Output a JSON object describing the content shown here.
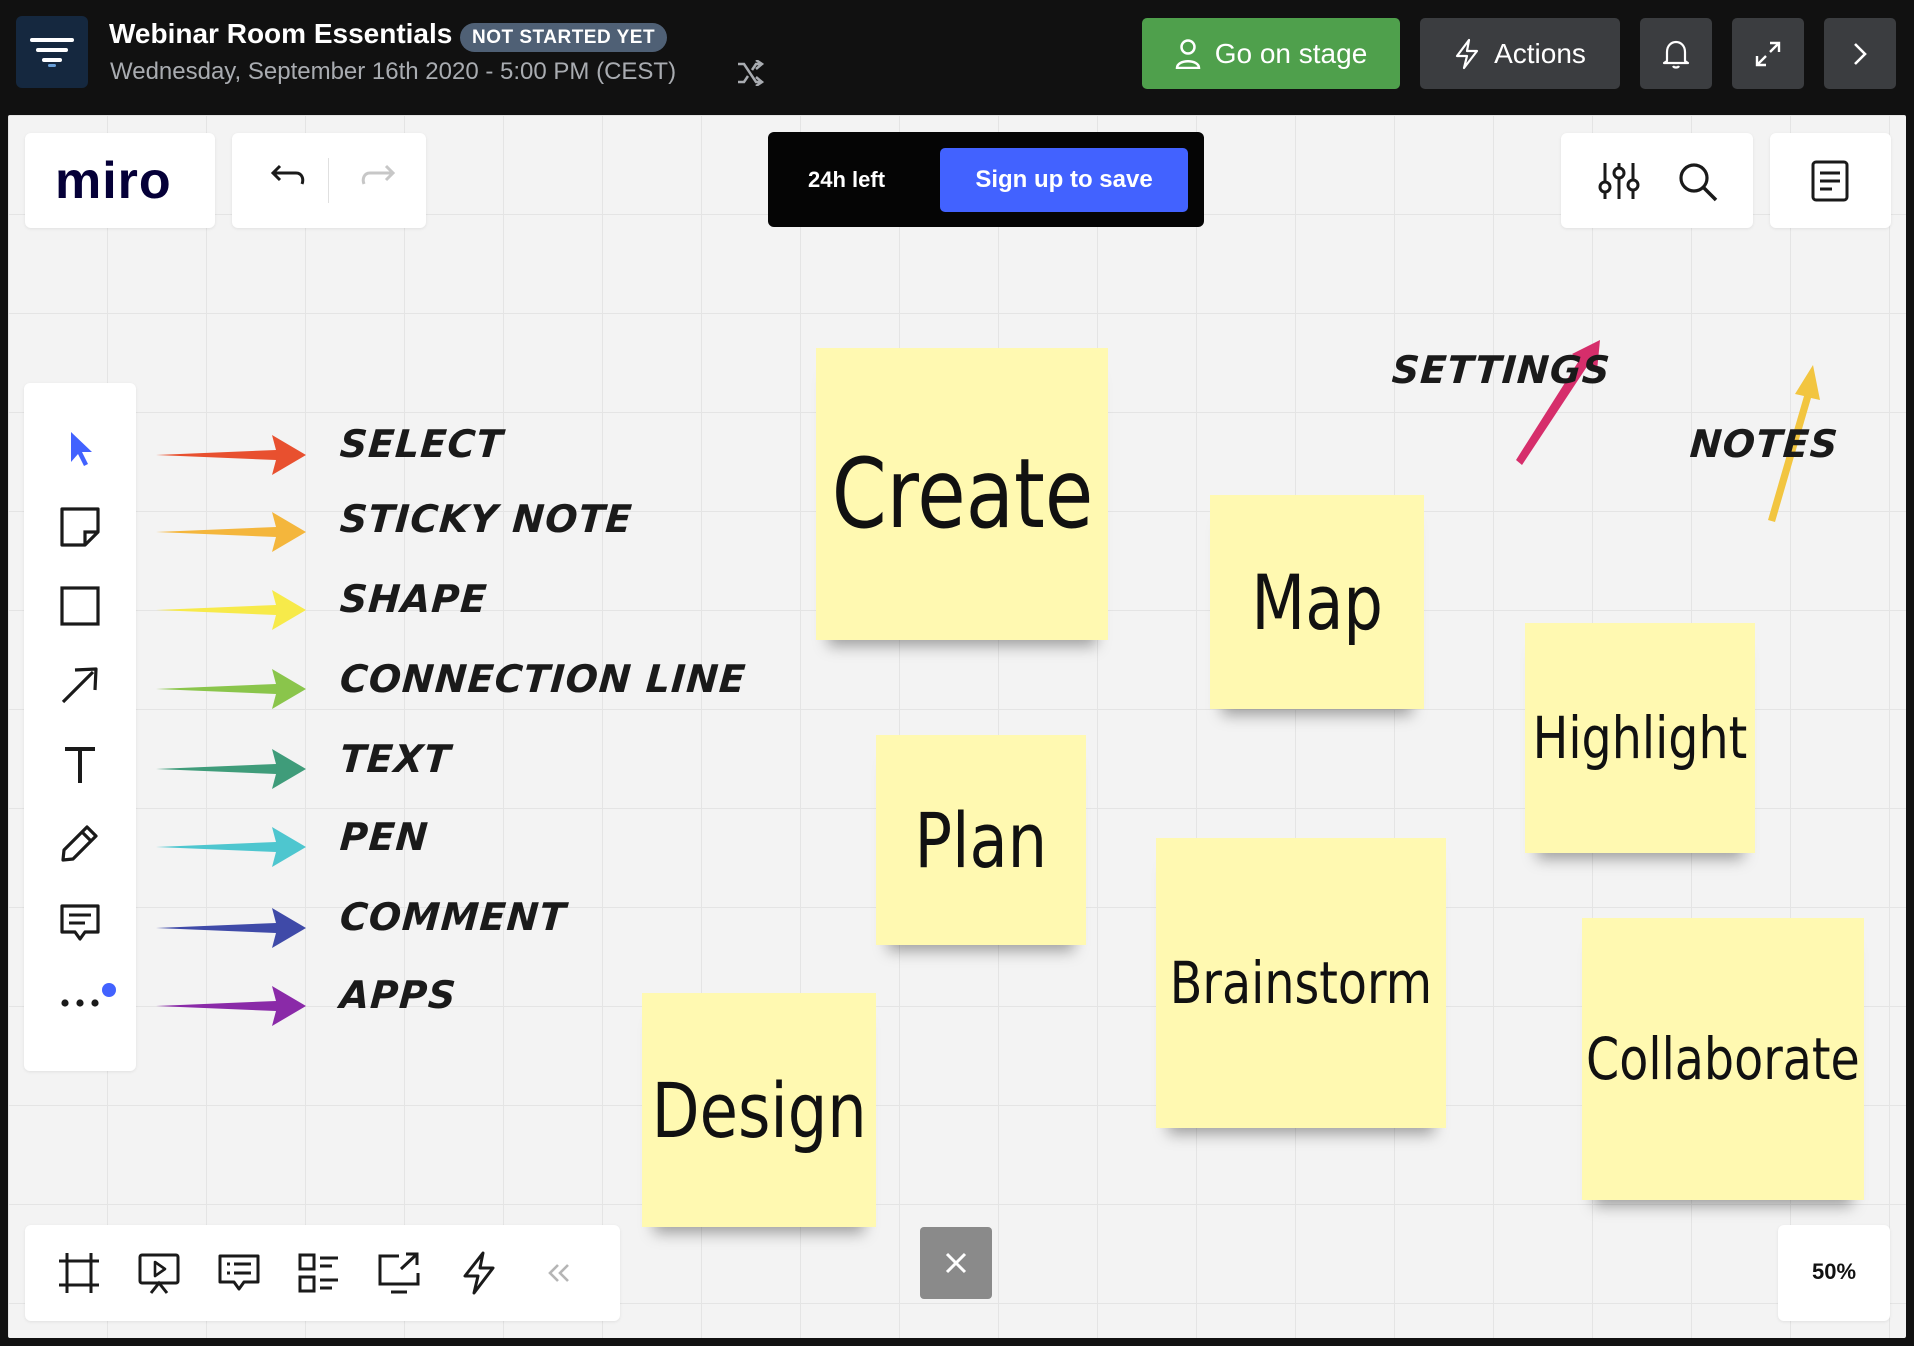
{
  "header": {
    "title": "Webinar Room Essentials",
    "status": "NOT STARTED YET",
    "datetime": "Wednesday, September 16th 2020 - 5:00 PM (CEST)",
    "go_on_stage_label": "Go on stage",
    "actions_label": "Actions",
    "colors": {
      "go_on_stage": "#4fa04c",
      "button_dark": "#3b3d40",
      "badge": "#4f6075"
    }
  },
  "board": {
    "logo": "miro",
    "time_left": "24h left",
    "signup_label": "Sign up to save",
    "zoom": "50%",
    "accent_color": "#4262ff"
  },
  "annotations": {
    "tools": [
      {
        "label": "SELECT",
        "arrow_color": "#e8502f"
      },
      {
        "label": "STICKY NOTE",
        "arrow_color": "#f4b63c"
      },
      {
        "label": "SHAPE",
        "arrow_color": "#f7ea4a"
      },
      {
        "label": "CONNECTION LINE",
        "arrow_color": "#8ac54b"
      },
      {
        "label": "TEXT",
        "arrow_color": "#3f9c7a"
      },
      {
        "label": "PEN",
        "arrow_color": "#4ec6cf"
      },
      {
        "label": "COMMENT",
        "arrow_color": "#3f4aa8"
      },
      {
        "label": "APPS",
        "arrow_color": "#8a2aa8"
      }
    ],
    "settings": {
      "label": "SETTINGS",
      "arrow_color": "#d62e6b"
    },
    "notes": {
      "label": "NOTES",
      "arrow_color": "#f2c540"
    }
  },
  "stickies": [
    {
      "text": "Create"
    },
    {
      "text": "Map"
    },
    {
      "text": "Highlight"
    },
    {
      "text": "Plan"
    },
    {
      "text": "Brainstorm"
    },
    {
      "text": "Collaborate"
    },
    {
      "text": "Design"
    }
  ],
  "icons": {
    "left_toolbar": [
      "cursor-icon",
      "sticky-note-icon",
      "square-icon",
      "connection-line-icon",
      "text-icon",
      "pen-icon",
      "comment-icon",
      "more-icon"
    ],
    "bottom_toolbar": [
      "frame-icon",
      "presentation-icon",
      "comments-list-icon",
      "card-list-icon",
      "screen-share-icon",
      "lightning-icon",
      "collapse-icon"
    ]
  }
}
